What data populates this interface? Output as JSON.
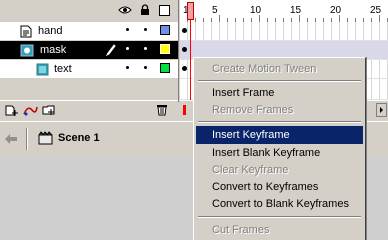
{
  "layers": [
    {
      "name": "hand",
      "color": "#6f8fe8",
      "selected": false
    },
    {
      "name": "mask",
      "color": "#ffff00",
      "selected": true
    },
    {
      "name": "text",
      "color": "#00e040",
      "selected": false
    }
  ],
  "header_icons": [
    "eye-icon",
    "lock-icon",
    "outline-icon"
  ],
  "ruler_numbers": [
    "1",
    "5",
    "10",
    "15",
    "20",
    "25"
  ],
  "editbar": {
    "scene_label": "Scene 1"
  },
  "context_menu": {
    "items": [
      {
        "label": "Create Motion Tween",
        "disabled": true,
        "highlighted": false
      },
      {
        "sep": true
      },
      {
        "label": "Insert Frame",
        "disabled": false,
        "highlighted": false
      },
      {
        "label": "Remove Frames",
        "disabled": true,
        "highlighted": false
      },
      {
        "sep": true
      },
      {
        "label": "Insert Keyframe",
        "disabled": false,
        "highlighted": true
      },
      {
        "label": "Insert Blank Keyframe",
        "disabled": false,
        "highlighted": false
      },
      {
        "label": "Clear Keyframe",
        "disabled": true,
        "highlighted": false
      },
      {
        "label": "Convert to Keyframes",
        "disabled": false,
        "highlighted": false
      },
      {
        "label": "Convert to Blank Keyframes",
        "disabled": false,
        "highlighted": false
      },
      {
        "sep": true
      },
      {
        "label": "Cut Frames",
        "disabled": true,
        "highlighted": false
      }
    ]
  },
  "colors": {
    "menu_highlight": "#0a246a",
    "selected_layer": "#000000",
    "playhead": "#ff0000"
  }
}
